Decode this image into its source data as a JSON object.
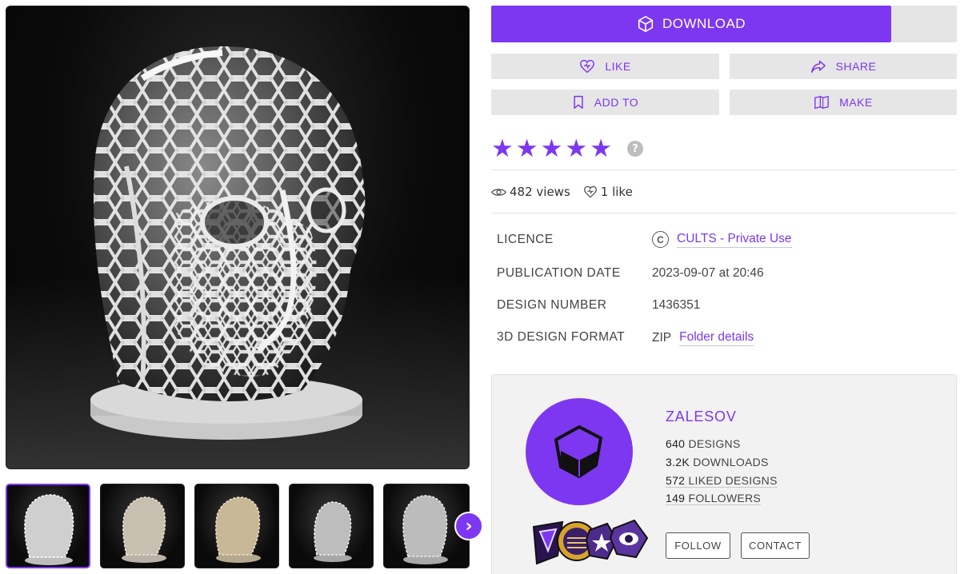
{
  "actions": {
    "download": "DOWNLOAD",
    "like": "LIKE",
    "share": "SHARE",
    "add_to": "ADD TO",
    "make": "MAKE"
  },
  "rating": {
    "stars": 5,
    "max": 5,
    "help": "?"
  },
  "stats": {
    "views": "482 views",
    "likes": "1 like"
  },
  "details": {
    "licence_label": "LICENCE",
    "licence_value": "CULTS - Private Use",
    "publication_label": "PUBLICATION DATE",
    "publication_value": "2023-09-07 at 20:46",
    "design_number_label": "DESIGN NUMBER",
    "design_number_value": "1436351",
    "format_label": "3D DESIGN FORMAT",
    "format_value": "ZIP",
    "format_link": "Folder details"
  },
  "creator": {
    "name": "ZALESOV",
    "designs_num": "640",
    "designs_label": "DESIGNS",
    "downloads_num": "3.2K",
    "downloads_label": "DOWNLOADS",
    "liked_num": "572",
    "liked_label": "LIKED DESIGNS",
    "followers_num": "149",
    "followers_label": "FOLLOWERS",
    "follow": "FOLLOW",
    "contact": "CONTACT"
  },
  "gallery": {
    "thumbnail_count": 5,
    "active_index": 0,
    "next_icon": "chevron-right-icon"
  },
  "colors": {
    "accent": "#7d37f0",
    "button_bg": "#e6e6e6",
    "card_bg": "#f2f2f2"
  }
}
